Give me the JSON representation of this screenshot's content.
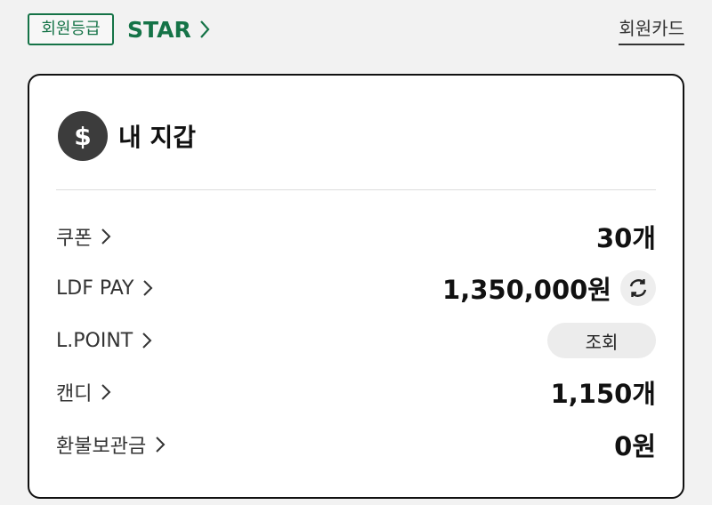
{
  "header": {
    "grade_badge_label": "회원등급",
    "grade_value": "STAR",
    "member_card_link": "회원카드"
  },
  "wallet": {
    "title": "내 지갑",
    "icon": "dollar-icon",
    "rows": [
      {
        "label": "쿠폰",
        "value": "30개"
      },
      {
        "label": "LDF PAY",
        "value": "1,350,000원",
        "action_icon": "refresh-icon"
      },
      {
        "label": "L.POINT",
        "button_label": "조회"
      },
      {
        "label": "캔디",
        "value": "1,150개"
      },
      {
        "label": "환불보관금",
        "value": "0원"
      }
    ]
  },
  "colors": {
    "brand_green": "#157347",
    "background": "#f2f2f2",
    "card_border": "#111111"
  }
}
